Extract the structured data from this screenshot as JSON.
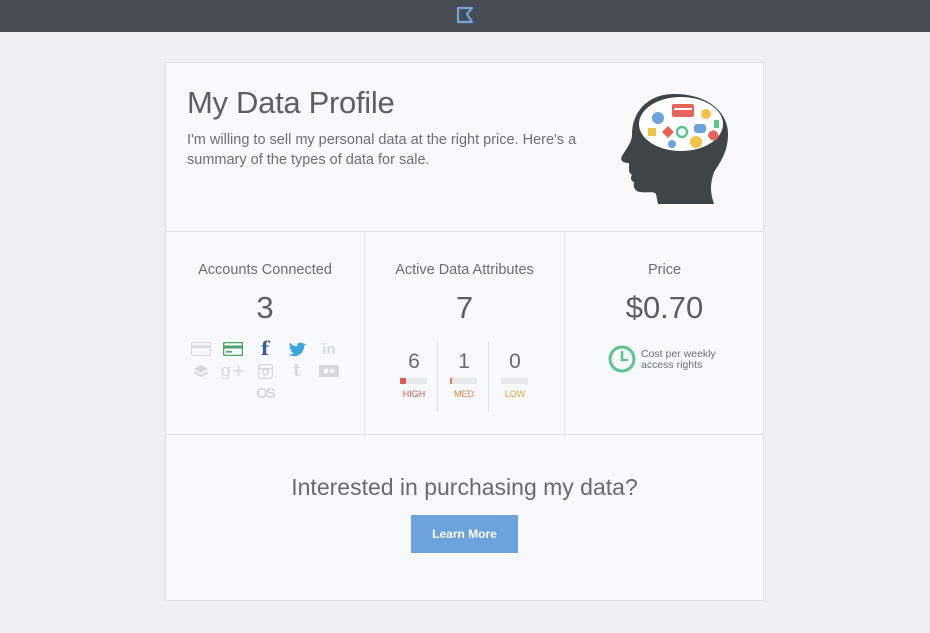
{
  "topbar": {
    "logo_icon": "flag-logo-icon",
    "logo_color": "#6fa6e0"
  },
  "profile": {
    "title": "My Data Profile",
    "description": "I'm willing to sell my personal data at the right price. Here's a summary of the types of data for sale.",
    "illustration": "head-brain-data-icon"
  },
  "accounts": {
    "title": "Accounts Connected",
    "count": "3",
    "icons": [
      {
        "name": "credit-card-icon",
        "connected": false
      },
      {
        "name": "bank-card-icon",
        "connected": true,
        "color": "#49a36b"
      },
      {
        "name": "facebook-icon",
        "connected": true,
        "color": "#3b5998"
      },
      {
        "name": "twitter-icon",
        "connected": true,
        "color": "#3aa6dc"
      },
      {
        "name": "linkedin-icon",
        "connected": false
      },
      {
        "name": "foursquare-icon",
        "connected": false
      },
      {
        "name": "google-plus-icon",
        "connected": false
      },
      {
        "name": "instagram-icon",
        "connected": false
      },
      {
        "name": "tumblr-icon",
        "connected": false
      },
      {
        "name": "flickr-icon",
        "connected": false
      },
      {
        "name": "lastfm-icon",
        "connected": false
      }
    ]
  },
  "attributes": {
    "title": "Active Data Attributes",
    "count": "7",
    "levels": [
      {
        "value": "6",
        "label": "HIGH",
        "color": "#e05a4f",
        "fill": 0.22
      },
      {
        "value": "1",
        "label": "MED",
        "color": "#e8804a",
        "fill": 0.06
      },
      {
        "value": "0",
        "label": "LOW",
        "color": "#e8a83a",
        "fill": 0.0
      }
    ]
  },
  "price": {
    "title": "Price",
    "value": "$0.70",
    "note_line1": "Cost per weekly",
    "note_line2": "access rights",
    "clock_color": "#5cc48f"
  },
  "cta": {
    "title": "Interested in purchasing my data?",
    "button_label": "Learn More",
    "button_color": "#6ca3dc"
  }
}
